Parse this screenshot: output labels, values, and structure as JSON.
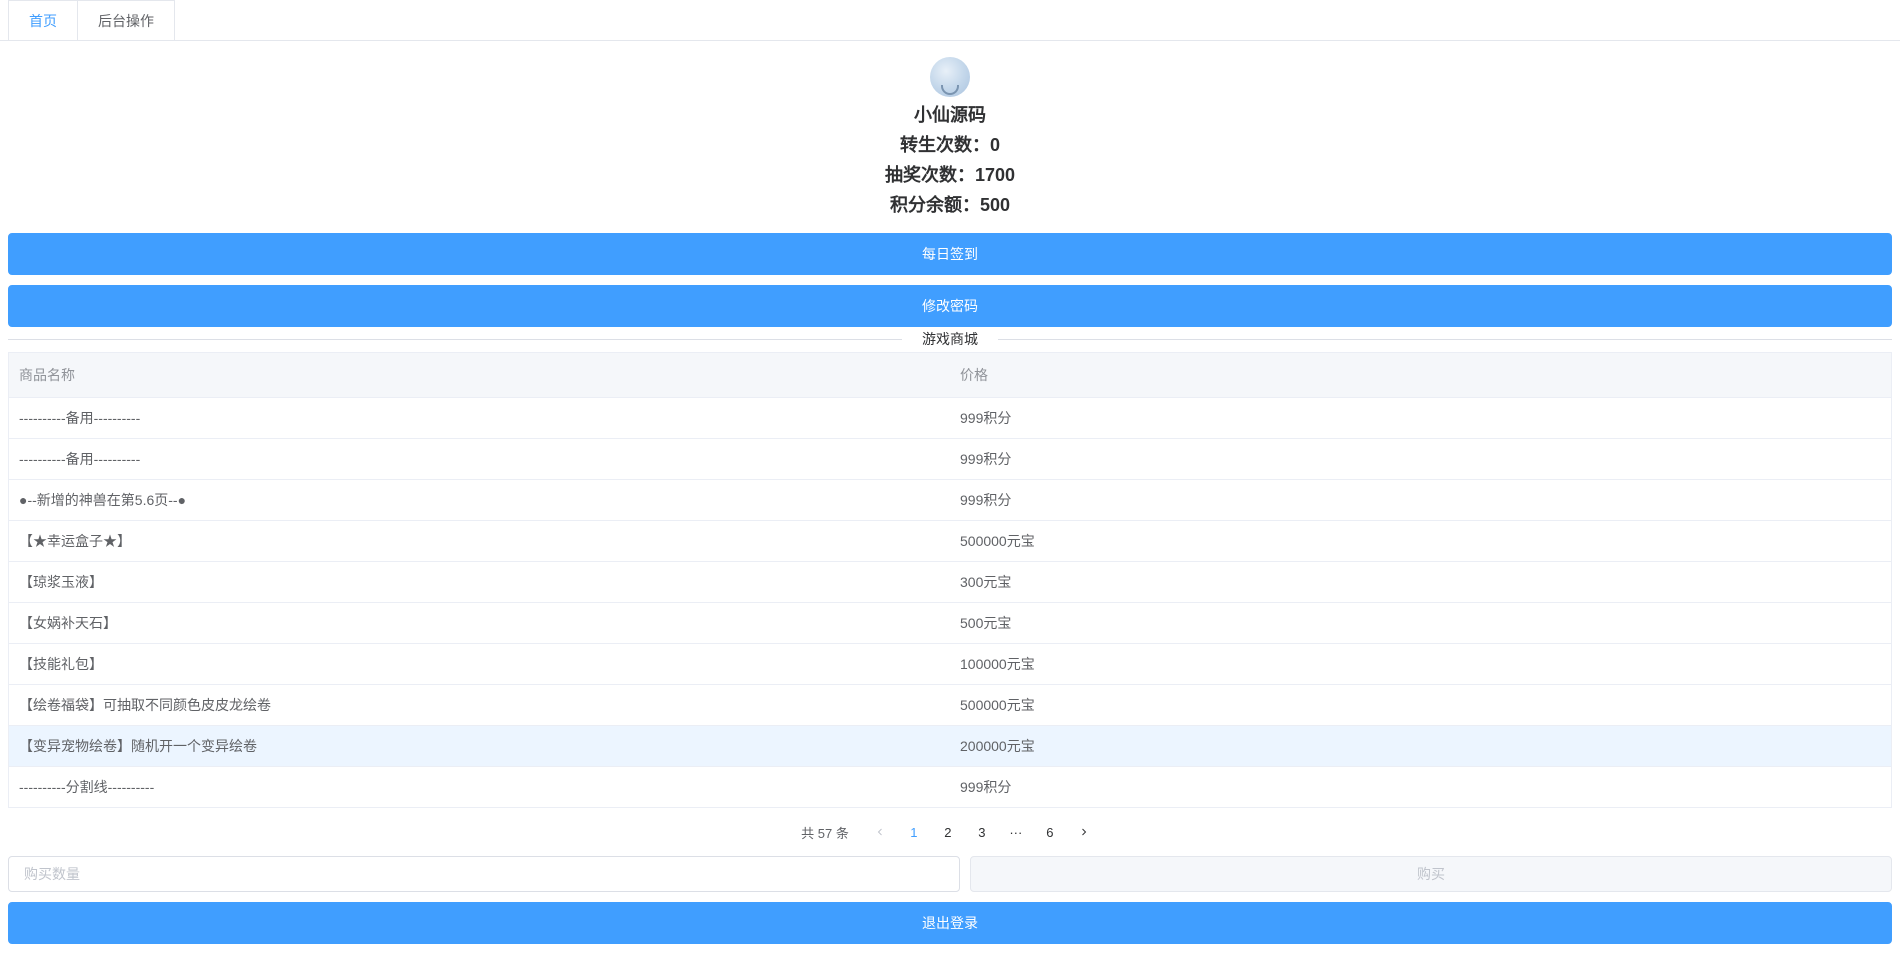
{
  "tabs": {
    "home": "首页",
    "admin": "后台操作"
  },
  "profile": {
    "name": "小仙源码",
    "rebirth_label": "转生次数：",
    "rebirth_value": "0",
    "lottery_label": "抽奖次数：",
    "lottery_value": "1700",
    "points_label": "积分余额：",
    "points_value": "500"
  },
  "buttons": {
    "daily_checkin": "每日签到",
    "change_password": "修改密码",
    "buy": "购买",
    "logout": "退出登录"
  },
  "shop": {
    "title": "游戏商城",
    "headers": {
      "name": "商品名称",
      "price": "价格"
    },
    "rows": [
      {
        "name": "----------备用----------",
        "price": "999积分"
      },
      {
        "name": "----------备用----------",
        "price": "999积分"
      },
      {
        "name": "●--新增的神兽在第5.6页--●",
        "price": "999积分"
      },
      {
        "name": "【★幸运盒子★】",
        "price": "500000元宝"
      },
      {
        "name": "【琼浆玉液】",
        "price": "300元宝"
      },
      {
        "name": "【女娲补天石】",
        "price": "500元宝"
      },
      {
        "name": "【技能礼包】",
        "price": "100000元宝"
      },
      {
        "name": "【绘卷福袋】可抽取不同颜色皮皮龙绘卷",
        "price": "500000元宝"
      },
      {
        "name": "【变异宠物绘卷】随机开一个变异绘卷",
        "price": "200000元宝"
      },
      {
        "name": "----------分割线----------",
        "price": "999积分"
      }
    ]
  },
  "pagination": {
    "total_text": "共 57 条",
    "pages": [
      "1",
      "2",
      "3",
      "6"
    ],
    "ellipsis": "···",
    "current": 1
  },
  "inputs": {
    "quantity_placeholder": "购买数量"
  }
}
